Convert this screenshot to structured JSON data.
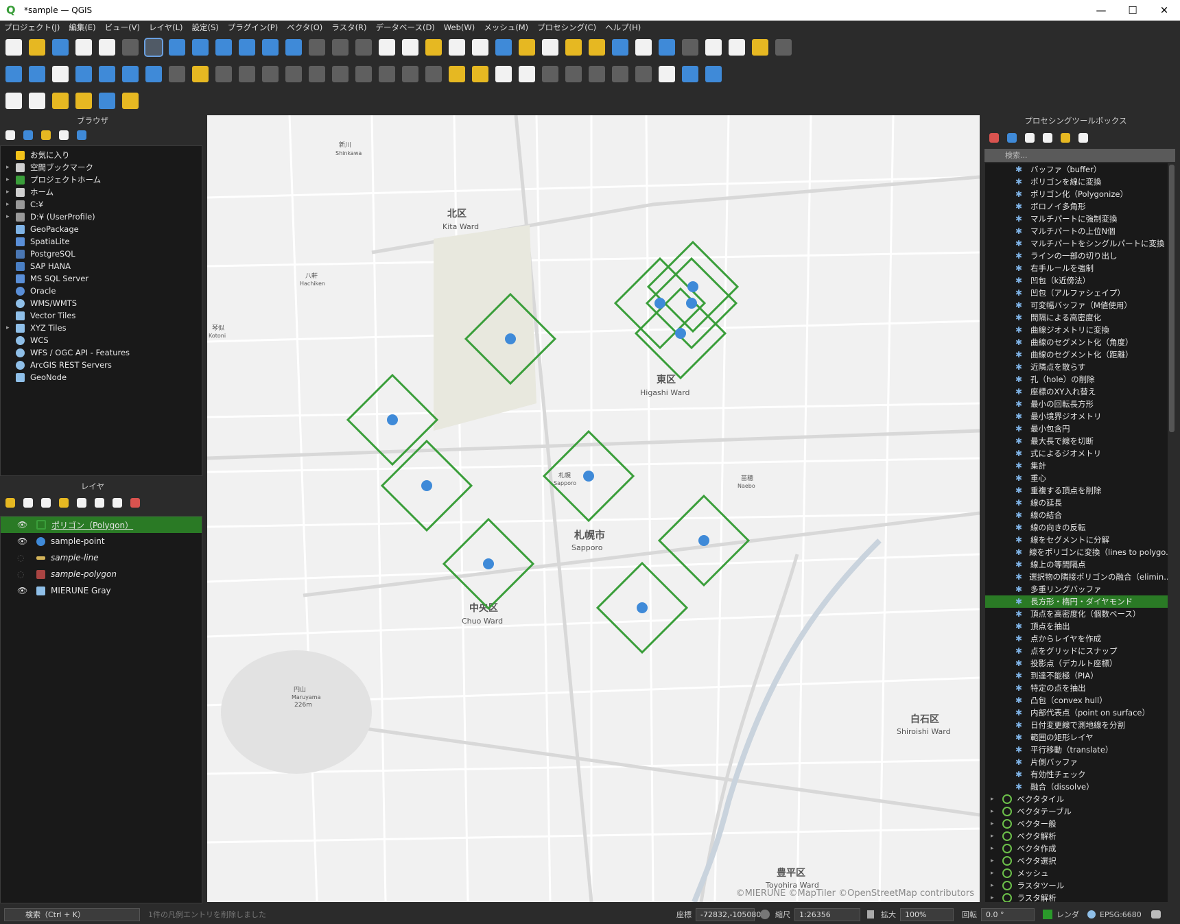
{
  "window": {
    "title": "*sample — QGIS",
    "minimize": "—",
    "maximize": "☐",
    "close": "✕"
  },
  "menu": [
    "プロジェクト(J)",
    "編集(E)",
    "ビュー(V)",
    "レイヤ(L)",
    "設定(S)",
    "プラグイン(P)",
    "ベクタ(O)",
    "ラスタ(R)",
    "データベース(D)",
    "Web(W)",
    "メッシュ(M)",
    "プロセシング(C)",
    "ヘルプ(H)"
  ],
  "browser": {
    "title": "ブラウザ",
    "items": [
      {
        "label": "お気に入り",
        "icon": "star-icon",
        "color": "#f2c21a",
        "arrow": ""
      },
      {
        "label": "空間ブックマーク",
        "icon": "bookmark-icon",
        "color": "#cfcfcf",
        "arrow": "▸"
      },
      {
        "label": "プロジェクトホーム",
        "icon": "project-home-icon",
        "color": "#3a9e3a",
        "arrow": "▸"
      },
      {
        "label": "ホーム",
        "icon": "home-icon",
        "color": "#d0d0d0",
        "arrow": "▸"
      },
      {
        "label": "C:¥",
        "icon": "drive-icon",
        "color": "#9a9a9a",
        "arrow": "▸"
      },
      {
        "label": "D:¥ (UserProfile)",
        "icon": "drive-icon",
        "color": "#9a9a9a",
        "arrow": "▸"
      },
      {
        "label": "GeoPackage",
        "icon": "geopackage-icon",
        "color": "#7fb3e6",
        "arrow": ""
      },
      {
        "label": "SpatiaLite",
        "icon": "spatialite-icon",
        "color": "#5a8fd8",
        "arrow": ""
      },
      {
        "label": "PostgreSQL",
        "icon": "postgresql-icon",
        "color": "#4a77b4",
        "arrow": ""
      },
      {
        "label": "SAP HANA",
        "icon": "sap-hana-icon",
        "color": "#4a7fc4",
        "arrow": ""
      },
      {
        "label": "MS SQL Server",
        "icon": "mssql-icon",
        "color": "#5a8fd8",
        "arrow": ""
      },
      {
        "label": "Oracle",
        "icon": "oracle-icon",
        "color": "#5a8fd8",
        "arrow": ""
      },
      {
        "label": "WMS/WMTS",
        "icon": "wms-icon",
        "color": "#8fbfe8",
        "arrow": ""
      },
      {
        "label": "Vector Tiles",
        "icon": "vector-tiles-icon",
        "color": "#8fbfe8",
        "arrow": ""
      },
      {
        "label": "XYZ Tiles",
        "icon": "xyz-tiles-icon",
        "color": "#8fbfe8",
        "arrow": "▸"
      },
      {
        "label": "WCS",
        "icon": "wcs-icon",
        "color": "#8fbfe8",
        "arrow": ""
      },
      {
        "label": "WFS / OGC API - Features",
        "icon": "wfs-icon",
        "color": "#8fbfe8",
        "arrow": ""
      },
      {
        "label": "ArcGIS REST Servers",
        "icon": "arcgis-icon",
        "color": "#8fbfe8",
        "arrow": ""
      },
      {
        "label": "GeoNode",
        "icon": "geonode-icon",
        "color": "#8fbfe8",
        "arrow": ""
      }
    ]
  },
  "layers": {
    "title": "レイヤ",
    "items": [
      {
        "label": "ポリゴン（Polygon）",
        "visible": true,
        "selected": true,
        "swatch": "#3a9e3a",
        "italic": false
      },
      {
        "label": "sample-point",
        "visible": true,
        "selected": false,
        "swatch": "#3f8ad8",
        "italic": false
      },
      {
        "label": "sample-line",
        "visible": false,
        "selected": false,
        "swatch": "#d4b45a",
        "italic": true
      },
      {
        "label": "sample-polygon",
        "visible": false,
        "selected": false,
        "swatch": "#a94442",
        "italic": true
      },
      {
        "label": "MIERUNE Gray",
        "visible": true,
        "selected": false,
        "swatch": "#5a5a5a",
        "italic": false
      }
    ]
  },
  "map": {
    "labels": [
      {
        "text": "北区",
        "size": 14,
        "bold": true
      },
      {
        "text": "Kita Ward",
        "size": 11,
        "bold": false
      },
      {
        "text": "東区",
        "size": 14,
        "bold": true
      },
      {
        "text": "Higashi Ward",
        "size": 11,
        "bold": false
      },
      {
        "text": "札幌市",
        "size": 15,
        "bold": true
      },
      {
        "text": "Sapporo",
        "size": 11,
        "bold": false
      },
      {
        "text": "中央区",
        "size": 14,
        "bold": true
      },
      {
        "text": "Chuo Ward",
        "size": 11,
        "bold": false
      },
      {
        "text": "白石区",
        "size": 14,
        "bold": true
      },
      {
        "text": "Shiroishi Ward",
        "size": 11,
        "bold": false
      },
      {
        "text": "豊平区",
        "size": 14,
        "bold": true
      },
      {
        "text": "Toyohira Ward",
        "size": 11,
        "bold": false
      },
      {
        "text": "新川",
        "size": 9,
        "bold": false
      },
      {
        "text": "Shinkawa",
        "size": 8,
        "bold": false
      },
      {
        "text": "八軒",
        "size": 9,
        "bold": false
      },
      {
        "text": "Hachiken",
        "size": 8,
        "bold": false
      },
      {
        "text": "琴似",
        "size": 9,
        "bold": false
      },
      {
        "text": "Kotoni",
        "size": 8,
        "bold": false
      },
      {
        "text": "札幌",
        "size": 9,
        "bold": false
      },
      {
        "text": "Sapporo",
        "size": 8,
        "bold": false
      },
      {
        "text": "苗穂",
        "size": 9,
        "bold": false
      },
      {
        "text": "Naebo",
        "size": 8,
        "bold": false
      },
      {
        "text": "円山",
        "size": 9,
        "bold": false
      },
      {
        "text": "Maruyama",
        "size": 8,
        "bold": false
      },
      {
        "text": "226m",
        "size": 9,
        "bold": false
      }
    ],
    "attribution": "©MIERUNE ©MapTiler ©OpenStreetMap contributors",
    "point_color": "#3f8ad8",
    "diamond_color": "#3a9e3a",
    "feature_count": 12
  },
  "toolbox": {
    "title": "プロセシングツールボックス",
    "search_placeholder": "検索...",
    "items": [
      "バッファ（buffer）",
      "ポリゴンを線に変換",
      "ポリゴン化（Polygonize）",
      "ボロノイ多角形",
      "マルチパートに強制変換",
      "マルチパートの上位N個",
      "マルチパートをシングルパートに変換",
      "ラインの一部の切り出し",
      "右手ルールを強制",
      "凹包（k近傍法）",
      "凹包（アルファシェイプ）",
      "可変幅バッファ（M値使用）",
      "間隔による高密度化",
      "曲線ジオメトリに変換",
      "曲線のセグメント化（角度）",
      "曲線のセグメント化（距離）",
      "近隣点を散らす",
      "孔（hole）の削除",
      "座標のXY入れ替え",
      "最小の回転長方形",
      "最小境界ジオメトリ",
      "最小包含円",
      "最大長で線を切断",
      "式によるジオメトリ",
      "集計",
      "重心",
      "重複する頂点を削除",
      "線の延長",
      "線の結合",
      "線の向きの反転",
      "線をセグメントに分解",
      "線をポリゴンに変換（lines to polygo...",
      "線上の等間隔点",
      "選択物の隣接ポリゴンの融合（elimin...",
      "多重リングバッファ",
      "長方形・楕円・ダイヤモンド",
      "頂点を高密度化（個数ベース）",
      "頂点を抽出",
      "点からレイヤを作成",
      "点をグリッドにスナップ",
      "投影点（デカルト座標）",
      "到達不能極（PIA）",
      "特定の点を抽出",
      "凸包（convex hull）",
      "内部代表点（point on surface）",
      "日付変更線で測地線を分割",
      "範囲の矩形レイヤ",
      "平行移動（translate）",
      "片側バッファ",
      "有効性チェック",
      "融合（dissolve）"
    ],
    "selected_index": 35,
    "groups": [
      "ベクタタイル",
      "ベクタテーブル",
      "ベクター般",
      "ベクタ解析",
      "ベクタ作成",
      "ベクタ選択",
      "メッシュ",
      "ラスタツール",
      "ラスタ解析"
    ]
  },
  "status": {
    "search_placeholder": "検索（Ctrl + K）",
    "message": "1件の凡例エントリを削除しました",
    "coord_label": "座標",
    "coord_value": "-72832,-105080",
    "scale_label": "縮尺",
    "scale_value": "1:26356",
    "magnify_label": "拡大",
    "magnify_value": "100%",
    "rotation_label": "回転",
    "rotation_value": "0.0 °",
    "render_label": "レンダ",
    "crs": "EPSG:6680"
  }
}
